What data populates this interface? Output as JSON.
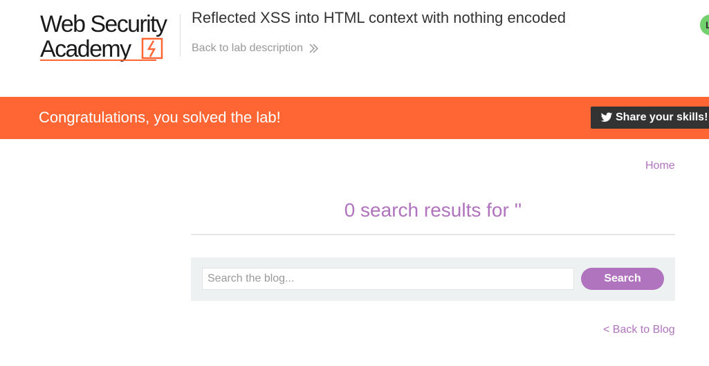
{
  "header": {
    "logo": {
      "line1": "Web Security",
      "line2": "Academy",
      "accent": "#ff6633"
    },
    "lab_title": "Reflected XSS into HTML context with nothing encoded",
    "back_to_description": "Back to lab description",
    "status_initial": "L"
  },
  "banner": {
    "message": "Congratulations, you solved the lab!",
    "share_label": "Share your skills!",
    "share_icon": "twitter-icon",
    "background": "#ff6633"
  },
  "nav": {
    "home_label": "Home"
  },
  "main": {
    "results_title": "0 search results for ''",
    "search": {
      "placeholder": "Search the blog...",
      "value": "",
      "button_label": "Search"
    },
    "back_to_blog": "< Back to Blog"
  },
  "colors": {
    "accent": "#b073be",
    "banner": "#ff6633",
    "dark": "#333333"
  }
}
